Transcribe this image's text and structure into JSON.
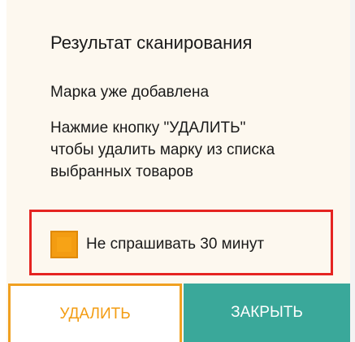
{
  "dialog": {
    "title": "Результат сканирования",
    "status": "Марка уже добавлена",
    "instruction_lines": [
      "Нажмие кнопку \"УДАЛИТЬ\"",
      "чтобы удалить марку из списка",
      "выбранных товаров"
    ],
    "dont_ask": {
      "label": "Не спрашивать 30 минут",
      "checked": true
    },
    "buttons": {
      "delete_label": "УДАЛИТЬ",
      "close_label": "ЗАКРЫТЬ"
    }
  },
  "colors": {
    "accent_orange": "#f39c12",
    "highlight_red": "#e52421",
    "close_teal": "#3aa89a",
    "background": "#fdf8ef"
  }
}
